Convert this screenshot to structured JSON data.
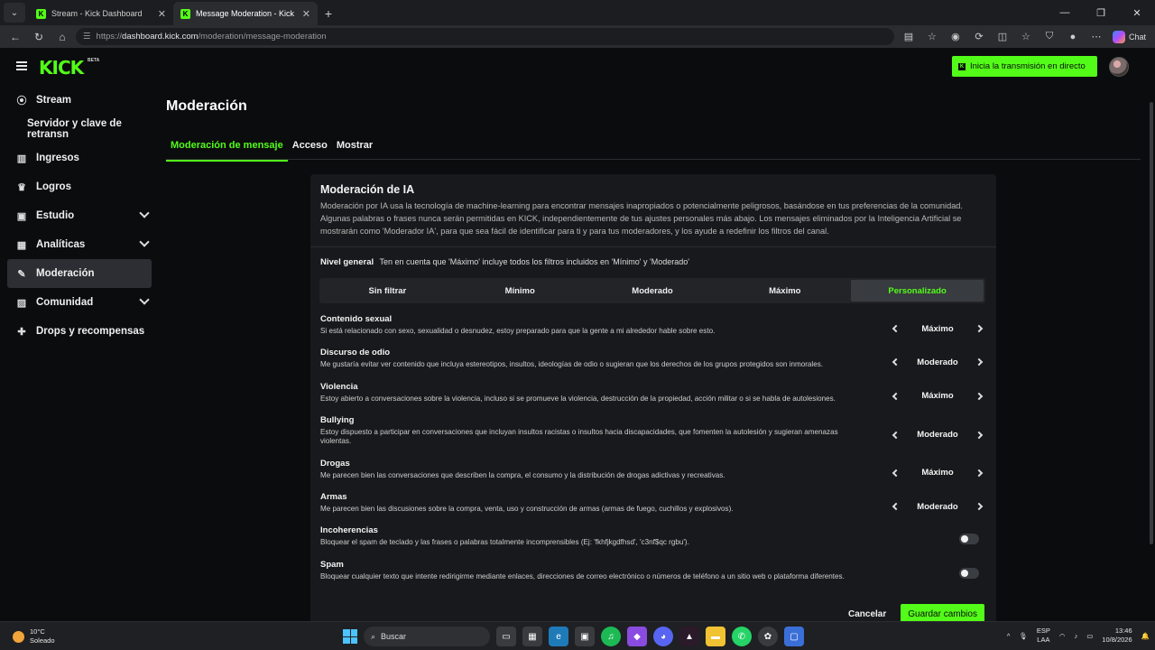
{
  "browser": {
    "tabs": [
      {
        "label": "Stream - Kick Dashboard",
        "active": false
      },
      {
        "label": "Message Moderation - Kick Dashb",
        "active": true
      }
    ],
    "url_prefix": "https://",
    "url_host": "dashboard.kick.com",
    "url_path": "/moderation/message-moderation",
    "chat_label": "Chat"
  },
  "header": {
    "logo": "KICK",
    "beta": "BETA",
    "live_button": "Inicia la transmisión en directo"
  },
  "sidebar": {
    "items": [
      {
        "label": "Stream",
        "icon": "broadcast-icon"
      },
      {
        "label": "Servidor y clave de retransn",
        "icon": ""
      },
      {
        "label": "Ingresos",
        "icon": "chart-icon"
      },
      {
        "label": "Logros",
        "icon": "trophy-icon"
      },
      {
        "label": "Estudio",
        "icon": "studio-icon"
      },
      {
        "label": "Analíticas",
        "icon": "analytics-icon"
      },
      {
        "label": "Moderación",
        "icon": "wrench-icon"
      },
      {
        "label": "Comunidad",
        "icon": "community-icon"
      },
      {
        "label": "Drops y recompensas",
        "icon": "gift-icon"
      }
    ]
  },
  "page": {
    "title": "Moderación",
    "tabs": [
      "Moderación de mensaje",
      "Acceso",
      "Mostrar"
    ]
  },
  "card": {
    "title": "Moderación de IA",
    "description": "Moderación por IA usa la tecnología de machine-learning para encontrar mensajes inapropiados o potencialmente peligrosos, basándose en tus preferencias de la comunidad. Algunas palabras o frases nunca serán permitidas en KICK, independientemente de tus ajustes personales más abajo. Los mensajes eliminados por la Inteligencia Artificial se mostrarán como 'Moderador IA', para que sea fácil de identificar para ti y para tus moderadores, y los ayude a redefinir los filtros del canal.",
    "level_label": "Nivel general",
    "level_hint": "Ten en cuenta que 'Máximo' incluye todos los filtros incluidos en 'Mínimo' y 'Moderado'",
    "levels": [
      "Sin filtrar",
      "Mínimo",
      "Moderado",
      "Máximo",
      "Personalizado"
    ],
    "selected_level": "Personalizado",
    "rules": [
      {
        "name": "Contenido sexual",
        "desc": "Si está relacionado con sexo, sexualidad o desnudez, estoy preparado para que la gente a mi alrededor hable sobre esto.",
        "value": "Máximo"
      },
      {
        "name": "Discurso de odio",
        "desc": "Me gustaría evitar ver contenido que incluya estereotipos, insultos, ideologías de odio o sugieran que los derechos de los grupos protegidos son inmorales.",
        "value": "Moderado"
      },
      {
        "name": "Violencia",
        "desc": "Estoy abierto a conversaciones sobre la violencia, incluso si se promueve la violencia, destrucción de la propiedad, acción militar o si se habla de autolesiones.",
        "value": "Máximo"
      },
      {
        "name": "Bullying",
        "desc": "Estoy dispuesto a participar en conversaciones que incluyan insultos racistas o insultos hacia discapacidades, que fomenten la autolesión y sugieran amenazas violentas.",
        "value": "Moderado"
      },
      {
        "name": "Drogas",
        "desc": "Me parecen bien las conversaciones que describen la compra, el consumo y la distribución de drogas adictivas y recreativas.",
        "value": "Máximo"
      },
      {
        "name": "Armas",
        "desc": "Me parecen bien las discusiones sobre la compra, venta, uso y construcción de armas (armas de fuego, cuchillos y explosivos).",
        "value": "Moderado"
      }
    ],
    "toggles": [
      {
        "name": "Incoherencias",
        "desc": "Bloquear el spam de teclado y las frases o palabras totalmente incomprensibles (Ej: 'fkhfjkgdfhsd', 'c3nf$qc rgbu').",
        "on": false
      },
      {
        "name": "Spam",
        "desc": "Bloquear cualquier texto que intente redirigirme mediante enlaces, direcciones de correo electrónico o números de teléfono a un sitio web o plataforma diferentes.",
        "on": false
      }
    ],
    "cancel": "Cancelar",
    "save": "Guardar cambios"
  },
  "taskbar": {
    "temp": "10°C",
    "weather": "Soleado",
    "search": "Buscar",
    "lang1": "ESP",
    "lang2": "LAA",
    "time": "13:46",
    "date": "10/8/2026"
  },
  "colors": {
    "accent": "#53fc18",
    "bg": "#0b0c0e",
    "card": "#18191c"
  }
}
